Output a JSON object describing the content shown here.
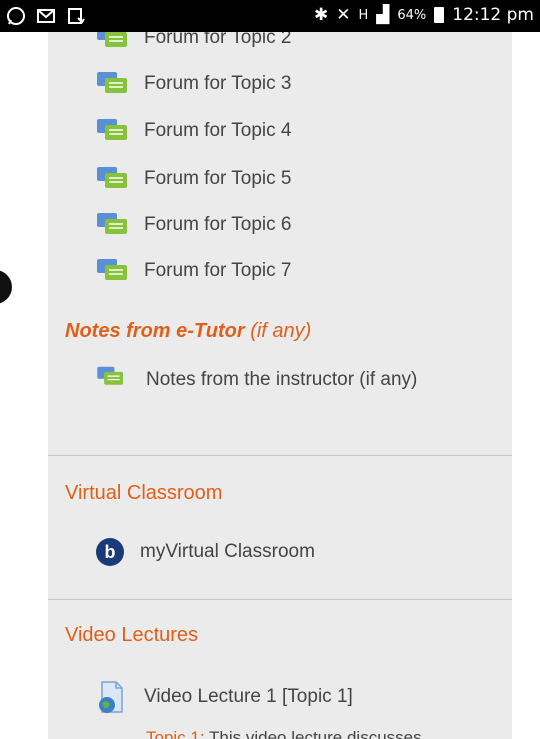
{
  "status_bar": {
    "battery": "64%",
    "time": "12:12 pm",
    "network": "H"
  },
  "forums": [
    {
      "label": "Forum for Topic 2"
    },
    {
      "label": "Forum for Topic 3"
    },
    {
      "label": "Forum for Topic 4"
    },
    {
      "label": "Forum for Topic 5"
    },
    {
      "label": "Forum for Topic 6"
    },
    {
      "label": "Forum for Topic 7"
    }
  ],
  "notes_section": {
    "title_bold": "Notes from e-Tutor",
    "title_light": " (if any)",
    "item_label": "Notes from the instructor (if any)"
  },
  "virtual_classroom": {
    "title": "Virtual Classroom",
    "item_label": "myVirtual Classroom",
    "icon_letter": "b"
  },
  "video_lectures": {
    "title": "Video Lectures",
    "item_label": "Video Lecture 1 [Topic 1]",
    "description_accent": "Topic 1:",
    "description_rest": " This video lecture discusses"
  },
  "colors": {
    "accent": "#e0601a",
    "page_bg": "#ebebeb",
    "text": "#444444"
  }
}
